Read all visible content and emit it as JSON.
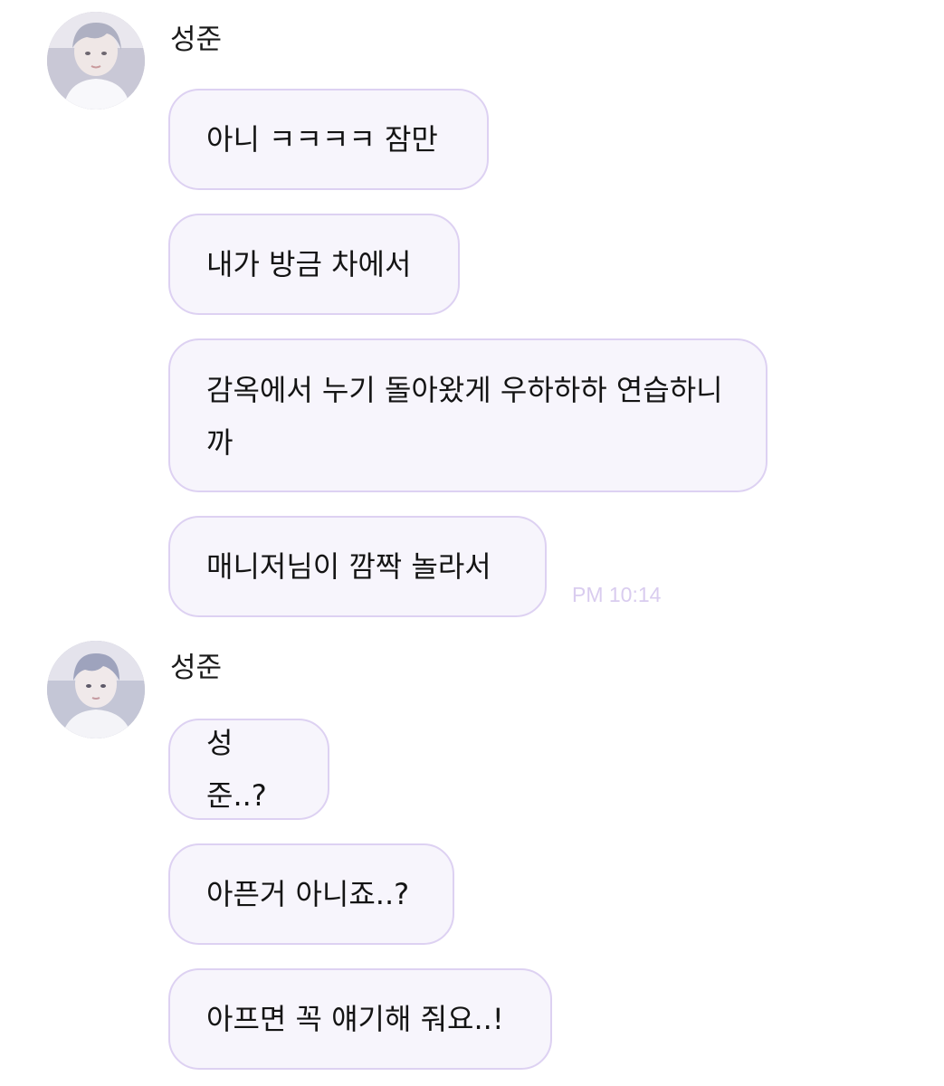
{
  "groups": [
    {
      "sender": "성준",
      "avatar_icon": "profile-photo",
      "messages": [
        "아니 ㅋㅋㅋㅋ 잠만",
        "내가 방금 차에서",
        "감옥에서 누기 돌아왔게 우하하하 연습하니까",
        "매니저님이 깜짝 놀라서"
      ],
      "time": "PM 10:14"
    },
    {
      "sender": "성준",
      "avatar_icon": "profile-photo",
      "messages": [
        "성준..?",
        "아픈거 아니죠..?",
        "아프면 꼭 얘기해 줘요..!"
      ]
    }
  ],
  "colors": {
    "bubble_bg": "#f7f5fc",
    "bubble_border": "#ddd1f2",
    "timestamp": "#d9ccef"
  }
}
